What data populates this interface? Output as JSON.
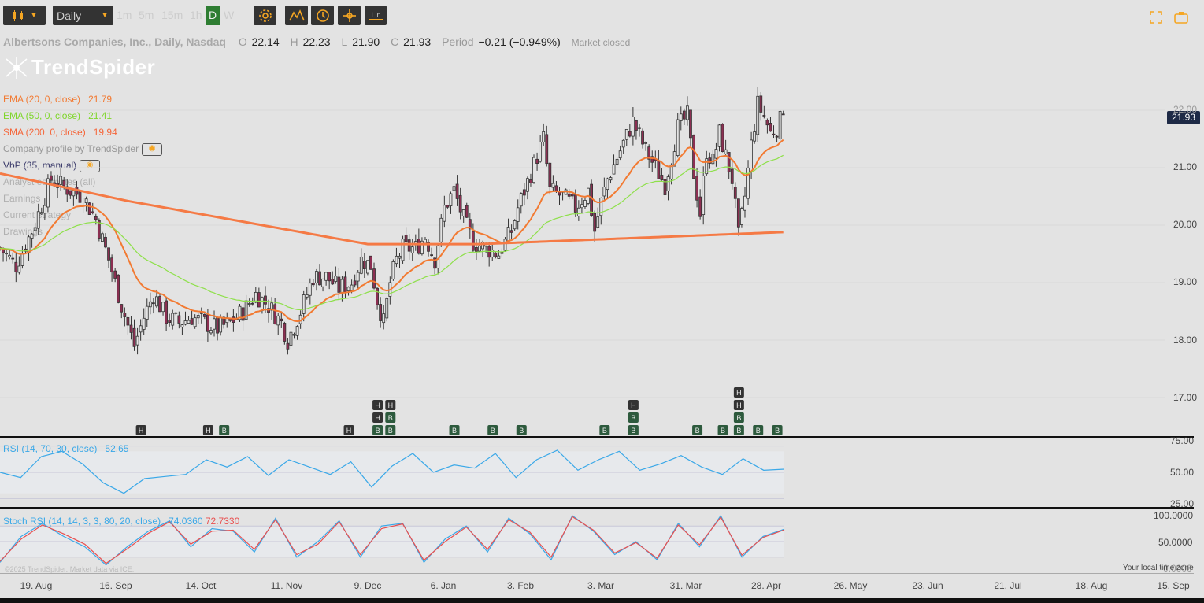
{
  "toolbar": {
    "interval_select": "Daily",
    "intervals": [
      "1m",
      "5m",
      "15m",
      "1h",
      "D",
      "W"
    ],
    "active_interval": "D",
    "chart_type_btn": "Lin"
  },
  "header": {
    "symbol": "Albertsons Companies, Inc., Daily, Nasdaq",
    "o_label": "O",
    "o_value": "22.14",
    "h_label": "H",
    "h_value": "22.23",
    "l_label": "L",
    "l_value": "21.90",
    "c_label": "C",
    "c_value": "21.93",
    "period_label": "Period",
    "period_value": "−0.21 (−0.949%)",
    "status": "Market closed"
  },
  "logo": "TrendSpider",
  "legend": {
    "ema20": {
      "label": "EMA (20, 0, close)",
      "value": "21.79",
      "color": "#f27a32"
    },
    "ema50": {
      "label": "EMA (50, 0, close)",
      "value": "21.41",
      "color": "#7fd62a"
    },
    "sma200": {
      "label": "SMA (200, 0, close)",
      "value": "19.94",
      "color": "#f5663a"
    },
    "company_profile": "Company profile by TrendSpider",
    "vbp": "VbP (35, manual)",
    "analyst": "Analyst estimates (all)",
    "earnings": "Earnings",
    "strategy": "Current strategy",
    "drawings": "Drawings"
  },
  "last_price": "21.93",
  "rsi_legend": {
    "label": "RSI (14, 70, 30, close)",
    "value": "52.65"
  },
  "stoch_legend": {
    "label": "Stoch RSI (14, 14, 3, 3, 80, 20, close)",
    "k": "74.0360",
    "d": "72.7330"
  },
  "copyright": "©2025 TrendSpider. Market data via ICE.",
  "timezone": "Your local time zone",
  "colors": {
    "up": "#3d6b35",
    "down": "#8c2f52",
    "ema20": "#f27a32",
    "ema50": "#8ee04a",
    "sma200": "#f57a45",
    "rsi": "#3aa8e8",
    "stoch_k": "#3aa8e8",
    "stoch_d": "#e85050"
  },
  "chart_data": [
    {
      "type": "candlestick",
      "title": "Albertsons Companies, Inc., Daily, Nasdaq",
      "ylim": [
        16.7,
        23.0
      ],
      "y_ticks": [
        "17.00",
        "18.00",
        "19.00",
        "20.00",
        "21.00",
        "22.00"
      ],
      "x_ticks": [
        "19. Aug",
        "16. Sep",
        "14. Oct",
        "11. Nov",
        "9. Dec",
        "6. Jan",
        "3. Feb",
        "3. Mar",
        "31. Mar",
        "28. Apr",
        "26. May",
        "23. Jun",
        "21. Jul",
        "18. Aug",
        "15. Sep"
      ],
      "close_path": [
        [
          0,
          19.6
        ],
        [
          5,
          19.3
        ],
        [
          10,
          19.9
        ],
        [
          16,
          20.8
        ],
        [
          22,
          20.6
        ],
        [
          26,
          20.5
        ],
        [
          30,
          20.1
        ],
        [
          34,
          19.4
        ],
        [
          38,
          18.6
        ],
        [
          42,
          17.9
        ],
        [
          45,
          18.4
        ],
        [
          48,
          18.8
        ],
        [
          52,
          18.4
        ],
        [
          56,
          18.3
        ],
        [
          60,
          18.4
        ],
        [
          64,
          18.3
        ],
        [
          68,
          18.2
        ],
        [
          72,
          18.3
        ],
        [
          76,
          18.5
        ],
        [
          80,
          18.8
        ],
        [
          84,
          18.6
        ],
        [
          88,
          18.3
        ],
        [
          90,
          18.0
        ],
        [
          94,
          18.5
        ],
        [
          98,
          19.1
        ],
        [
          102,
          19.1
        ],
        [
          106,
          18.9
        ],
        [
          110,
          19.0
        ],
        [
          113,
          19.4
        ],
        [
          116,
          19.3
        ],
        [
          118,
          18.7
        ],
        [
          120,
          18.3
        ],
        [
          122,
          19.0
        ],
        [
          124,
          19.4
        ],
        [
          126,
          19.6
        ],
        [
          130,
          19.6
        ],
        [
          133,
          19.8
        ],
        [
          136,
          19.4
        ],
        [
          139,
          20.3
        ],
        [
          142,
          20.6
        ],
        [
          145,
          20.1
        ],
        [
          148,
          19.7
        ],
        [
          152,
          19.6
        ],
        [
          156,
          19.5
        ],
        [
          160,
          19.9
        ],
        [
          162,
          20.3
        ],
        [
          164,
          20.6
        ],
        [
          168,
          21.2
        ],
        [
          170,
          21.5
        ],
        [
          172,
          20.6
        ],
        [
          176,
          20.5
        ],
        [
          180,
          20.3
        ],
        [
          184,
          20.6
        ],
        [
          186,
          19.9
        ],
        [
          188,
          20.4
        ],
        [
          190,
          20.8
        ],
        [
          194,
          21.3
        ],
        [
          198,
          21.8
        ],
        [
          202,
          21.3
        ],
        [
          205,
          21.0
        ],
        [
          208,
          20.7
        ],
        [
          212,
          21.7
        ],
        [
          215,
          21.9
        ],
        [
          217,
          20.9
        ],
        [
          219,
          20.2
        ],
        [
          221,
          21.3
        ],
        [
          223,
          21.1
        ],
        [
          225,
          21.6
        ],
        [
          227,
          21.2
        ],
        [
          229,
          20.8
        ],
        [
          231,
          19.8
        ],
        [
          233,
          20.5
        ],
        [
          235,
          21.4
        ],
        [
          237,
          22.1
        ],
        [
          239,
          21.9
        ],
        [
          241,
          21.6
        ],
        [
          243,
          21.7
        ],
        [
          245,
          21.93
        ]
      ]
    },
    {
      "type": "line",
      "title": "RSI (14, 70, 30, close)",
      "ylim": [
        20,
        80
      ],
      "y_ticks": [
        "25.00",
        "50.00",
        "75.00"
      ],
      "series": [
        {
          "name": "RSI (14, 70, 30, close)",
          "values": [
            50,
            45,
            65,
            70,
            58,
            40,
            30,
            44,
            46,
            48,
            62,
            55,
            65,
            47,
            62,
            55,
            48,
            60,
            36,
            56,
            68,
            50,
            57,
            54,
            68,
            45,
            62,
            71,
            52,
            62,
            70,
            52,
            58,
            66,
            55,
            48,
            63,
            52,
            53
          ]
        }
      ]
    },
    {
      "type": "line",
      "title": "Stoch RSI (14, 14, 3, 3, 80, 20, close)",
      "ylim": [
        0,
        100
      ],
      "y_ticks": [
        "0.0000",
        "50.0000",
        "100.0000"
      ],
      "series": [
        {
          "name": "K",
          "values": [
            10,
            60,
            85,
            60,
            40,
            5,
            40,
            70,
            90,
            40,
            75,
            70,
            30,
            95,
            20,
            50,
            90,
            20,
            80,
            85,
            10,
            55,
            80,
            30,
            95,
            65,
            15,
            100,
            70,
            25,
            50,
            15,
            85,
            40,
            100,
            20,
            60,
            74
          ]
        },
        {
          "name": "D",
          "values": [
            12,
            55,
            82,
            65,
            45,
            8,
            36,
            66,
            88,
            45,
            70,
            72,
            35,
            92,
            25,
            45,
            88,
            25,
            75,
            84,
            14,
            50,
            78,
            35,
            92,
            68,
            20,
            98,
            72,
            28,
            48,
            18,
            82,
            44,
            97,
            24,
            58,
            72.7
          ]
        }
      ]
    }
  ]
}
